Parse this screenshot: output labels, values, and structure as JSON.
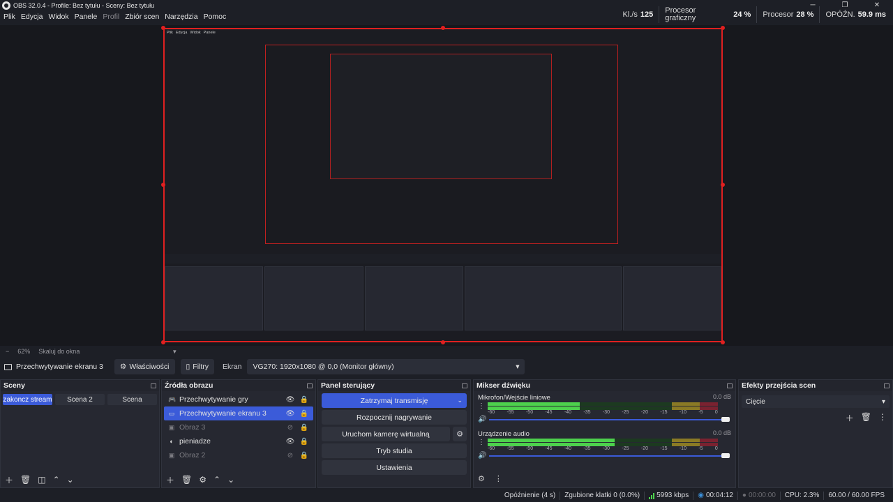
{
  "window": {
    "title": "OBS 32.0.4 - Profile: Bez tytułu - Sceny: Bez tytułu",
    "controls": [
      "─",
      "❐",
      "✕"
    ]
  },
  "menu": [
    "Plik",
    "Edycja",
    "Widok",
    "Panele",
    "Profil",
    "Zbiór scen",
    "Narzędzia",
    "Pomoc"
  ],
  "stats": {
    "fps_label": "Kl./s",
    "fps_value": "125",
    "gpu_label_1": "Procesor",
    "gpu_label_2": "graficzny",
    "gpu_value": "24 %",
    "cpu_label": "Procesor",
    "cpu_value": "28 %",
    "delay_label": "OPÓŹN.",
    "delay_value": "59.9 ms"
  },
  "zoom": {
    "minus": "−",
    "value": "62%",
    "mode": "Skaluj do okna",
    "caret": "▼"
  },
  "source_bar": {
    "source_name": "Przechwytywanie ekranu 3",
    "properties": "Właściwości",
    "filters": "Filtry",
    "screen_label": "Ekran",
    "screen_value": "VG270: 1920x1080 @ 0,0 (Monitor główny)"
  },
  "scenes": {
    "title": "Sceny",
    "items": [
      "zakoncz stream",
      "Scena 2",
      "Scena"
    ]
  },
  "sources": {
    "title": "Źródła obrazu",
    "items": [
      {
        "label": "Przechwytywanie gry",
        "icon": "gamepad-icon"
      },
      {
        "label": "Przechwytywanie ekranu 3",
        "icon": "monitor-icon"
      },
      {
        "label": "Obraz 3",
        "icon": "image-icon"
      },
      {
        "label": "pieniadze",
        "icon": "browser-icon"
      },
      {
        "label": "Obraz 2",
        "icon": "image-icon"
      }
    ]
  },
  "controls": {
    "title": "Panel sterujący",
    "stop_stream": "Zatrzymaj transmisję",
    "start_recording": "Rozpocznij nagrywanie",
    "virtual_cam": "Uruchom kamerę wirtualną",
    "studio_mode": "Tryb studia",
    "settings": "Ustawienia"
  },
  "mixer": {
    "title": "Mikser dźwięku",
    "channels": [
      {
        "name": "Mikrofon/Wejście liniowe",
        "db": "0.0 dB",
        "level_fraction": 0.4
      },
      {
        "name": "Urządzenie audio",
        "db": "0.0 dB",
        "level_fraction": 0.55
      }
    ],
    "scale": [
      "-60",
      "-55",
      "-50",
      "-45",
      "-40",
      "-35",
      "-30",
      "-25",
      "-20",
      "-15",
      "-10",
      "-5",
      "0"
    ]
  },
  "transitions": {
    "title": "Efekty przejścia scen",
    "selected": "Cięcie"
  },
  "status": {
    "delay": "Opóźnienie (4 s)",
    "dropped": "Zgubione klatki 0 (0.0%)",
    "bitrate": "5993 kbps",
    "stream_time": "00:04:12",
    "rec_time": "00:00:00",
    "cpu": "CPU: 2.3%",
    "fps": "60.00 / 60.00 FPS"
  },
  "colors": {
    "accent": "#3b5bd9",
    "selection_border": "#e02020",
    "meter_green": "#4dd14d",
    "stream_live": "#3b8fd9"
  }
}
